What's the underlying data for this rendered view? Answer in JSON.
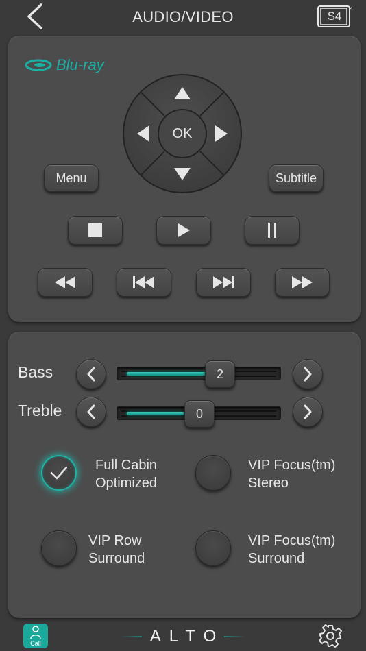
{
  "header": {
    "title": "AUDIO/VIDEO",
    "back_icon": "chevron-left-icon",
    "room_label": "S4"
  },
  "bluray": {
    "brand": "Blu-ray"
  },
  "dpad": {
    "ok_label": "OK"
  },
  "buttons": {
    "menu": "Menu",
    "subtitle": "Subtitle"
  },
  "transport": {
    "stop_icon": "stop-icon",
    "play_icon": "play-icon",
    "pause_icon": "pause-icon",
    "rewind_icon": "rewind-icon",
    "previous_icon": "skip-previous-icon",
    "next_icon": "skip-next-icon",
    "fast_forward_icon": "fast-forward-icon"
  },
  "audio": {
    "bass": {
      "label": "Bass",
      "value": "2"
    },
    "treble": {
      "label": "Treble",
      "value": "0"
    }
  },
  "modes": [
    {
      "label_line1": "Full Cabin",
      "label_line2": "Optimized",
      "selected": true
    },
    {
      "label_line1": "VIP Focus(tm)",
      "label_line2": "Stereo",
      "selected": false
    },
    {
      "label_line1": "VIP Row",
      "label_line2": "Surround",
      "selected": false
    },
    {
      "label_line1": "VIP Focus(tm)",
      "label_line2": "Surround",
      "selected": false
    }
  ],
  "footer": {
    "call_label": "Call",
    "brand": "ALTO"
  },
  "colors": {
    "accent": "#1fb3a5",
    "panel": "#4c4c4c",
    "background": "#3a3a3a"
  }
}
